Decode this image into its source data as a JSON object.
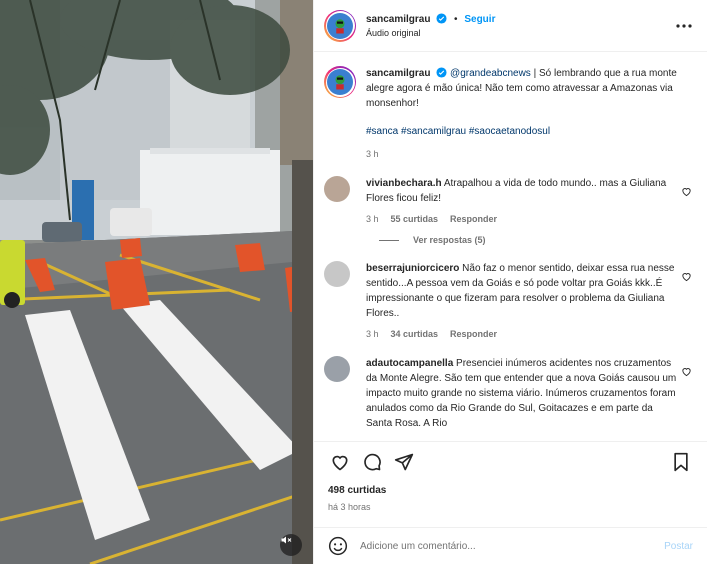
{
  "header": {
    "username": "sancamilgrau",
    "separator": "•",
    "follow_label": "Seguir",
    "audio": "Áudio original"
  },
  "caption": {
    "username": "sancamilgrau",
    "mention": "@grandeabcnews",
    "text": "| Só lembrando que a rua monte alegre agora é mão única! Não tem como atravessar a Amazonas via monsenhor!",
    "hashtags": [
      "#sanca",
      "#sancamilgrau",
      "#saocaetanodosul"
    ],
    "time": "3 h"
  },
  "comments": [
    {
      "username": "vivianbechara.h",
      "text": "Atrapalhou a vida de todo mundo.. mas a Giuliana Flores ficou feliz!",
      "time": "3 h",
      "likes": "55 curtidas",
      "reply_label": "Responder",
      "view_replies": "Ver respostas (5)"
    },
    {
      "username": "beserrajuniorcicero",
      "text": "Não faz o menor sentido, deixar essa rua nesse sentido...A pessoa vem da Goiás e só pode voltar pra Goiás kkk..É impressionante o que fizeram para resolver o problema da Giuliana Flores..",
      "time": "3 h",
      "likes": "34 curtidas",
      "reply_label": "Responder"
    },
    {
      "username": "adautocampanella",
      "text": "Presenciei inúmeros acidentes nos cruzamentos da Monte Alegre. São tem que entender que a nova Goiás causou um impacto muito grande no sistema viário. Inúmeros cruzamentos foram anulados como da Rio Grande do Sul, Goitacazes e em parte da Santa Rosa. A Rio"
    }
  ],
  "footer": {
    "likes": "498 curtidas",
    "time": "há 3 horas",
    "comment_placeholder": "Adicione um comentário...",
    "post_label": "Postar"
  },
  "icons": {
    "like": "heart-icon",
    "comment": "comment-icon",
    "share": "send-icon",
    "save": "bookmark-icon",
    "emoji": "emoji-icon",
    "options": "more-options-icon",
    "mute": "muted-speaker-icon"
  },
  "colors": {
    "link_blue": "#0095f6",
    "hashtag": "#00376b",
    "meta_gray": "#737373",
    "post_disabled": "#a8d4f8"
  }
}
